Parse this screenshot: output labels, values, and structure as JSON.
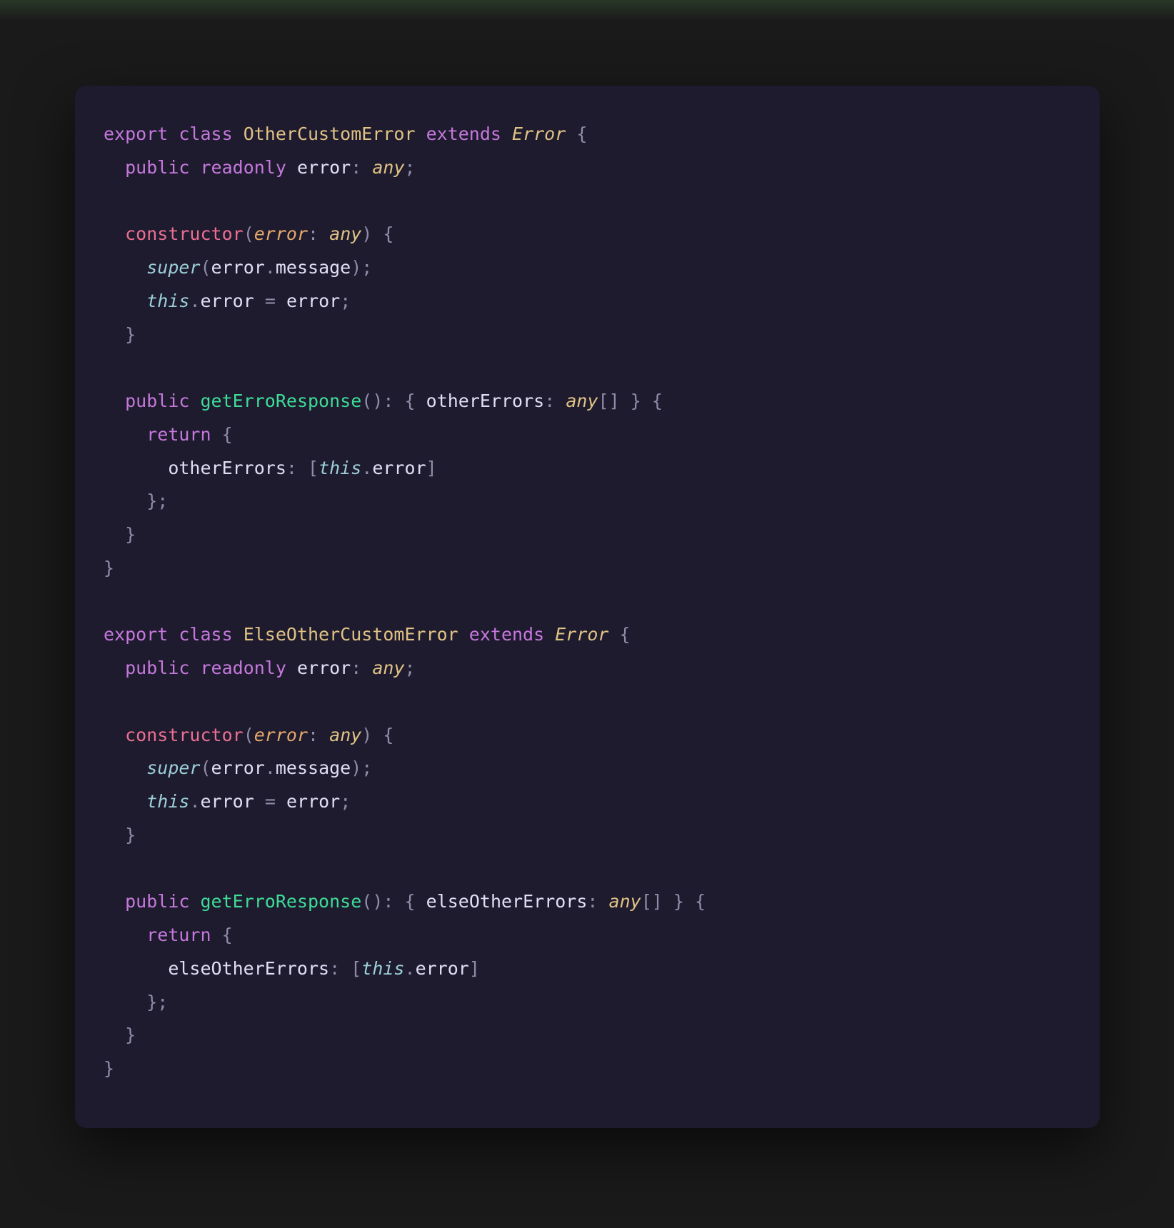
{
  "code": {
    "class1": {
      "name": "OtherCustomError",
      "extends": "Error",
      "field_type": "any",
      "field_name": "error",
      "ctor_param": "error",
      "ctor_param_type": "any",
      "method_name": "getErroResponse",
      "response_key": "otherErrors",
      "response_type": "any"
    },
    "class2": {
      "name": "ElseOtherCustomError",
      "extends": "Error",
      "field_type": "any",
      "field_name": "error",
      "ctor_param": "error",
      "ctor_param_type": "any",
      "method_name": "getErroResponse",
      "response_key": "elseOtherErrors",
      "response_type": "any"
    },
    "kw": {
      "export": "export",
      "class": "class",
      "extends": "extends",
      "public": "public",
      "readonly": "readonly",
      "constructor": "constructor",
      "super": "super",
      "this": "this",
      "return": "return"
    },
    "glyph": {
      "obrace": "{",
      "cbrace": "}",
      "oparen": "(",
      "cparen": ")",
      "obrack": "[",
      "cbrack": "]",
      "colon": ":",
      "semi": ";",
      "dot": ".",
      "eq": "=",
      "message": "message"
    }
  }
}
